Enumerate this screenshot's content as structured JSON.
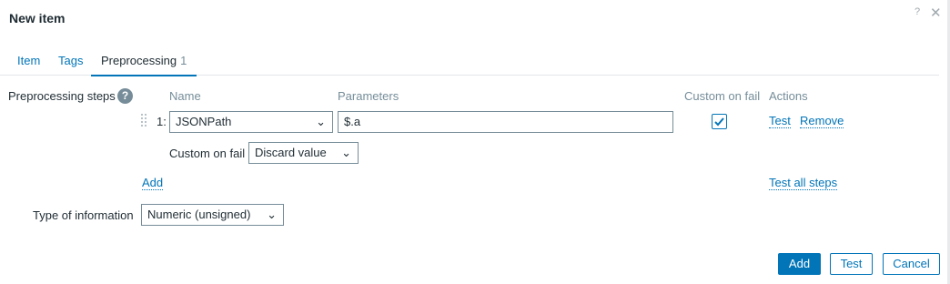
{
  "dialog": {
    "title": "New item",
    "help_glyph": "?",
    "close_glyph": "✕"
  },
  "tabs": [
    {
      "label": "Item"
    },
    {
      "label": "Tags"
    },
    {
      "label": "Preprocessing",
      "count": "1",
      "active": true
    }
  ],
  "preprocessing": {
    "section_label": "Preprocessing steps",
    "help_glyph": "?",
    "columns": {
      "name": "Name",
      "parameters": "Parameters",
      "custom_on_fail": "Custom on fail",
      "actions": "Actions"
    },
    "steps": [
      {
        "index": "1:",
        "name": "JSONPath",
        "parameter": "$.a",
        "custom_on_fail_checked": true,
        "test_label": "Test",
        "remove_label": "Remove",
        "custom_on_fail_label": "Custom on fail",
        "custom_on_fail_action": "Discard value"
      }
    ],
    "add_label": "Add",
    "test_all_label": "Test all steps"
  },
  "type_of_information": {
    "label": "Type of information",
    "value": "Numeric (unsigned)"
  },
  "footer": {
    "add_label": "Add",
    "test_label": "Test",
    "cancel_label": "Cancel"
  },
  "colors": {
    "accent": "#0275b8",
    "text": "#1f2c33",
    "muted": "#768d99"
  }
}
